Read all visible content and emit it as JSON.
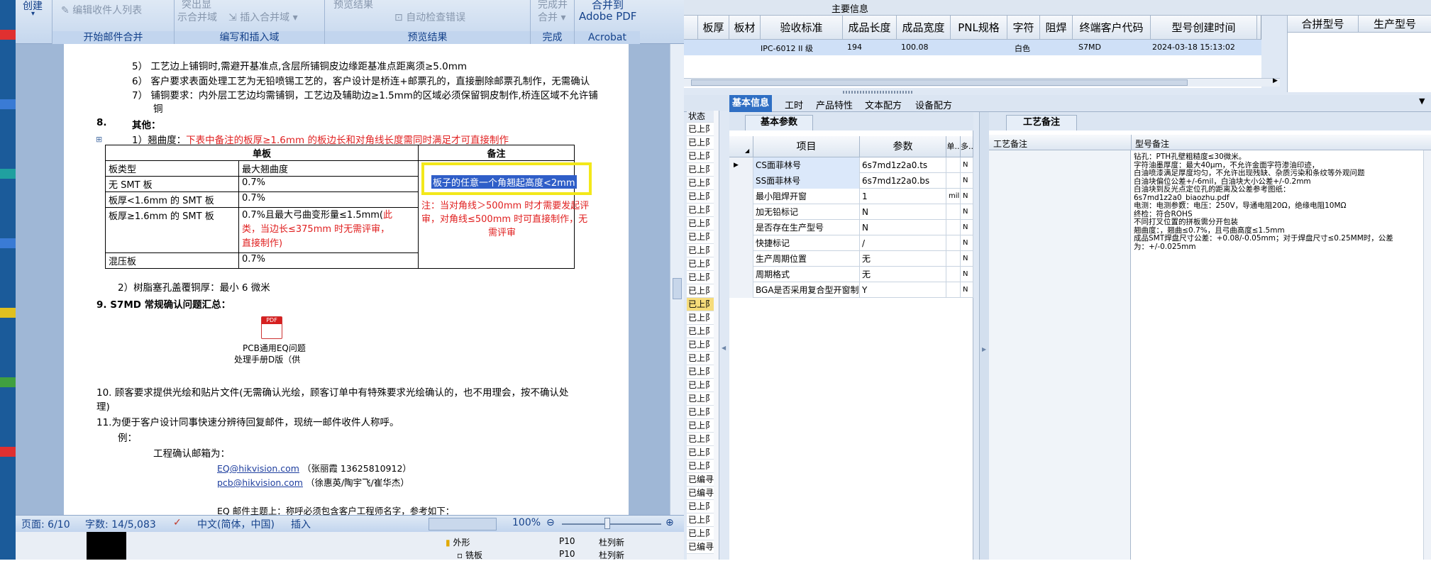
{
  "ribbon": {
    "create_label": "创建",
    "edit_recipients": "编辑收件人列表",
    "highlight_1": "突出显",
    "highlight_2": "示合并域",
    "insert_field": "插入合并域",
    "preview_results": "预览结果",
    "auto_check": "自动检查错误",
    "finish_1": "完成并",
    "finish_2": "合并",
    "merge_to": "合并到",
    "adobe_pdf": "Adobe PDF",
    "group_start": "开始邮件合并",
    "group_write": "编写和插入域",
    "group_preview": "预览结果",
    "group_finish": "完成",
    "group_acrobat": "Acrobat"
  },
  "doc": {
    "line5": "5）  工艺边上铺铜时,需避开基准点,含层所铺铜皮边缘距基准点距离须≥5.0mm",
    "line6": "6）  客户要求表面处理工艺为无铅喷锡工艺的，客户设计是桥连+邮票孔的，直接删除邮票孔制作，无需确认",
    "line7a": "7）  铺铜要求：内外层工艺边均需铺铜，工艺边及辅助边≥1.5mm的区域必须保留铜皮制作,桥连区域不允许铺",
    "line7b": "铜",
    "sec8_num": "8.",
    "sec8_title": "其他：",
    "item1_prefix": "1）翘曲度：",
    "item1_red": "下表中备注的板厚≥1.6mm 的板边长和对角线长度需同时满足才可直接制作",
    "table": {
      "h_single": "单板",
      "h_note": "备注",
      "r1c1": "板类型",
      "r1c2": "最大翘曲度",
      "r2c1": "无 SMT 板",
      "r2c2": "0.7%",
      "r3c1": "板厚<1.6mm 的 SMT 板",
      "r3c2": "0.7%",
      "r4c1": "板厚≥1.6mm 的 SMT 板",
      "r4c2a": "0.7%且最大弓曲变形量≤1.5mm(",
      "r4c2b": "此",
      "r4c2c": "类，当边长≤375mm 时无需评审，",
      "r4c2d": "直接制作)",
      "r5c1": "混压板",
      "r5c2": "0.7%",
      "note_highlight": "板子的任意一个角翘起高度<2mm",
      "note_red_1": "注：当对角线＞500mm 时才需要发起评",
      "note_red_2": "审，对角线≤500mm 时可直接制作，无",
      "note_red_3": "需评审"
    },
    "item2": "2）树脂塞孔盖覆铜厚：最小 6 微米",
    "sec9": "9.    S7MD 常规确认问题汇总：",
    "pdf_label_1": "PCB通用EQ问题",
    "pdf_label_2": "处理手册D版（供",
    "sec10a": "10.  顾客要求提供光绘和贴片文件(无需确认光绘，顾客订单中有特殊要求光绘确认的，也不用理会，按不确认处",
    "sec10b": "理)",
    "sec11": "11.为便于客户设计同事快速分辨待回复邮件，现统一邮件收件人称呼。",
    "example": "例：",
    "mailbox_label": "工程确认邮箱为：",
    "email1": "EQ@hikvision.com",
    "email1_note": "（张丽霞 13625810912）",
    "email2": "pcb@hikvision.com",
    "email2_note": "（徐惠英/陶宇飞/崔华杰）",
    "last_line": "EQ 邮件主题上：称呼必须包含客户工程师名字，参考如下："
  },
  "statusbar": {
    "page": "页面: 6/10",
    "words": "字数: 14/5,083",
    "lang": "中文(简体，中国)",
    "mode": "插入",
    "zoom": "100%"
  },
  "word_bottom": {
    "tree1": "外形",
    "tree1_a": "P10",
    "tree1_b": "杜列新",
    "tree2": "铣板",
    "tree2_a": "P10",
    "tree2_b": "杜列新"
  },
  "erp": {
    "main_info": "主要信息",
    "headers": [
      "板厚",
      "板材",
      "验收标准",
      "成品长度",
      "成品宽度",
      "PNL规格",
      "字符",
      "阻焊",
      "终端客户代码",
      "型号创建时间"
    ],
    "row": {
      "standard": "IPC-6012 II 级",
      "length": "194",
      "width": "100.08",
      "char": "白色",
      "customer": "S7MD",
      "created": "2024-03-18 15:13:02"
    },
    "right_headers": [
      "合拼型号",
      "生产型号"
    ],
    "tabs": [
      "基本信息",
      "工时",
      "产品特性",
      "文本配方",
      "设备配方"
    ],
    "subtab": "基本参数",
    "memo_tab": "工艺备注",
    "grid_headers": [
      "项目",
      "参数",
      "单..",
      "多.."
    ],
    "grid_rows": [
      {
        "item": "CS面菲林号",
        "param": "6s7md1z2a0.ts",
        "unit": "",
        "multi": "N"
      },
      {
        "item": "SS面菲林号",
        "param": "6s7md1z2a0.bs",
        "unit": "",
        "multi": "N"
      },
      {
        "item": "最小阻焊开窗",
        "param": "1",
        "unit": "mil",
        "multi": "N"
      },
      {
        "item": "加无铅标记",
        "param": "N",
        "unit": "",
        "multi": "N"
      },
      {
        "item": "是否存在生产型号",
        "param": "N",
        "unit": "",
        "multi": "N"
      },
      {
        "item": "快捷标记",
        "param": "/",
        "unit": "",
        "multi": "N"
      },
      {
        "item": "生产周期位置",
        "param": "无",
        "unit": "",
        "multi": "N"
      },
      {
        "item": "周期格式",
        "param": "无",
        "unit": "",
        "multi": "N"
      },
      {
        "item": "BGA是否采用复合型开窗制作",
        "param": "Y",
        "unit": "",
        "multi": "N"
      }
    ],
    "status_header": "状态",
    "status_items": [
      "已上阝",
      "已上阝",
      "已上阝",
      "已上阝",
      "已上阝",
      "已上阝",
      "已上阝",
      "已上阝",
      "已上阝",
      "已上阝",
      "已上阝",
      "已上阝",
      "已上阝",
      "已上阝",
      "已上阝",
      "已上阝",
      "已上阝",
      "已上阝",
      "已上阝",
      "已上阝",
      "已上阝",
      "已上阝",
      "已上阝",
      "已上阝",
      "已上阝",
      "已上阝",
      "已编寻",
      "已编寻",
      "已上阝",
      "已上阝",
      "已上阝",
      "已编寻"
    ],
    "memo_col1": "工艺备注",
    "memo_col2": "型号备注",
    "memo_lines": [
      "钻孔：PTH孔壁粗糙度≤30微米。",
      "字符油墨厚度：最大40μm，不允许金面字符渗油印迹，",
      "白油喷漆满足厚度均匀，不允许出现残缺、杂质污染和条纹等外观问题",
      "白油块偏位公差+/-6mil，白油块大小公差+/-0.2mm",
      "白油块到反光点定位孔的距离及公差参考图纸：",
      "6s7md1z2a0_biaozhu.pdf",
      "电测：电测参数：电压：250V，导通电阻20Ω，绝缘电阻10MΩ",
      "终检：符合ROHS",
      "不同打叉位置的拼板需分开包装",
      "翘曲度：，翘曲≤0.7%，且弓曲高度≤1.5mm",
      "成品SMT焊盘尺寸公差：+0.08/-0.05mm；对于焊盘尺寸≤0.25MM时，公差",
      "为：+/-0.025mm"
    ]
  }
}
